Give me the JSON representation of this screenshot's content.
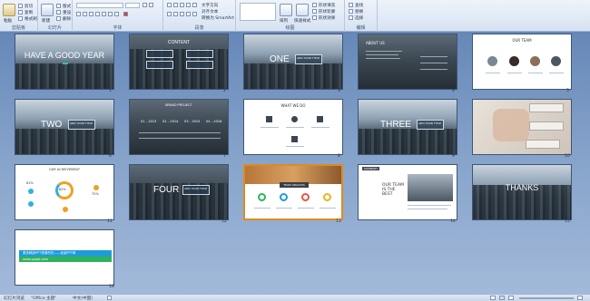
{
  "ribbon": {
    "groups": [
      {
        "label": "剪贴板"
      },
      {
        "label": "幻灯片"
      },
      {
        "label": "字体"
      },
      {
        "label": "段落"
      },
      {
        "label": "绘图"
      },
      {
        "label": "编辑"
      }
    ],
    "buttons": {
      "paste": "粘贴",
      "new_slide": "新建",
      "cut": "剪切",
      "copy": "复制",
      "format_painter": "格式刷",
      "layout": "版式",
      "reset": "重设",
      "delete": "删除",
      "text_direction": "文字方向",
      "align_text": "对齐文本",
      "convert_smartart": "转换为 SmartArt",
      "arrange": "排列",
      "quick_styles": "快速样式",
      "shape_fill": "形状填充",
      "shape_outline": "形状轮廓",
      "shape_effects": "形状效果",
      "find": "查找",
      "replace": "替换",
      "select": "选择"
    }
  },
  "slides": [
    {
      "n": "1",
      "title": "HAVE A GOOD YEAR"
    },
    {
      "n": "2",
      "title": "CONTENT"
    },
    {
      "n": "3",
      "title": "ONE",
      "chip": "ADD YOUR TITLE"
    },
    {
      "n": "4",
      "title": "ABOUT US"
    },
    {
      "n": "5",
      "title": "OUR TEAM"
    },
    {
      "n": "6",
      "title": "TWO",
      "chip": "ADD YOUR TITLE"
    },
    {
      "n": "7",
      "title": "BRAND PROJECT",
      "stats": [
        "01 – 2013",
        "02 – 2014",
        "03 – 2015",
        "04 – 2016"
      ]
    },
    {
      "n": "8",
      "title": "WHAT WE DO"
    },
    {
      "n": "9",
      "title": "THREE",
      "chip": "ADD YOUR TITLE"
    },
    {
      "n": "10",
      "title": ""
    },
    {
      "n": "11",
      "title": "OUR ACHIEVEMENT",
      "pct": [
        "82%",
        "61%",
        "72%"
      ]
    },
    {
      "n": "12",
      "title": "FOUR",
      "chip": "ADD YOUR TITLE"
    },
    {
      "n": "13",
      "title": "TEAM ANALYSIS"
    },
    {
      "n": "14",
      "title": "OUR TEAM IS THE BEST",
      "tag": "SUMMARY"
    },
    {
      "n": "15",
      "title": "THANKS"
    },
    {
      "n": "16",
      "title": "",
      "banner": "更多精品PPT资源尽在——优品PPT网",
      "url": "www.ypppt.com"
    }
  ],
  "status": {
    "slide_view": "幻灯片浏览",
    "theme": "\"Office 主题\"",
    "language": "中文(中国)"
  },
  "colors": {
    "selection": "#e08a1e",
    "banner_blue": "#1f9bd8",
    "banner_green": "#2fb35a"
  }
}
